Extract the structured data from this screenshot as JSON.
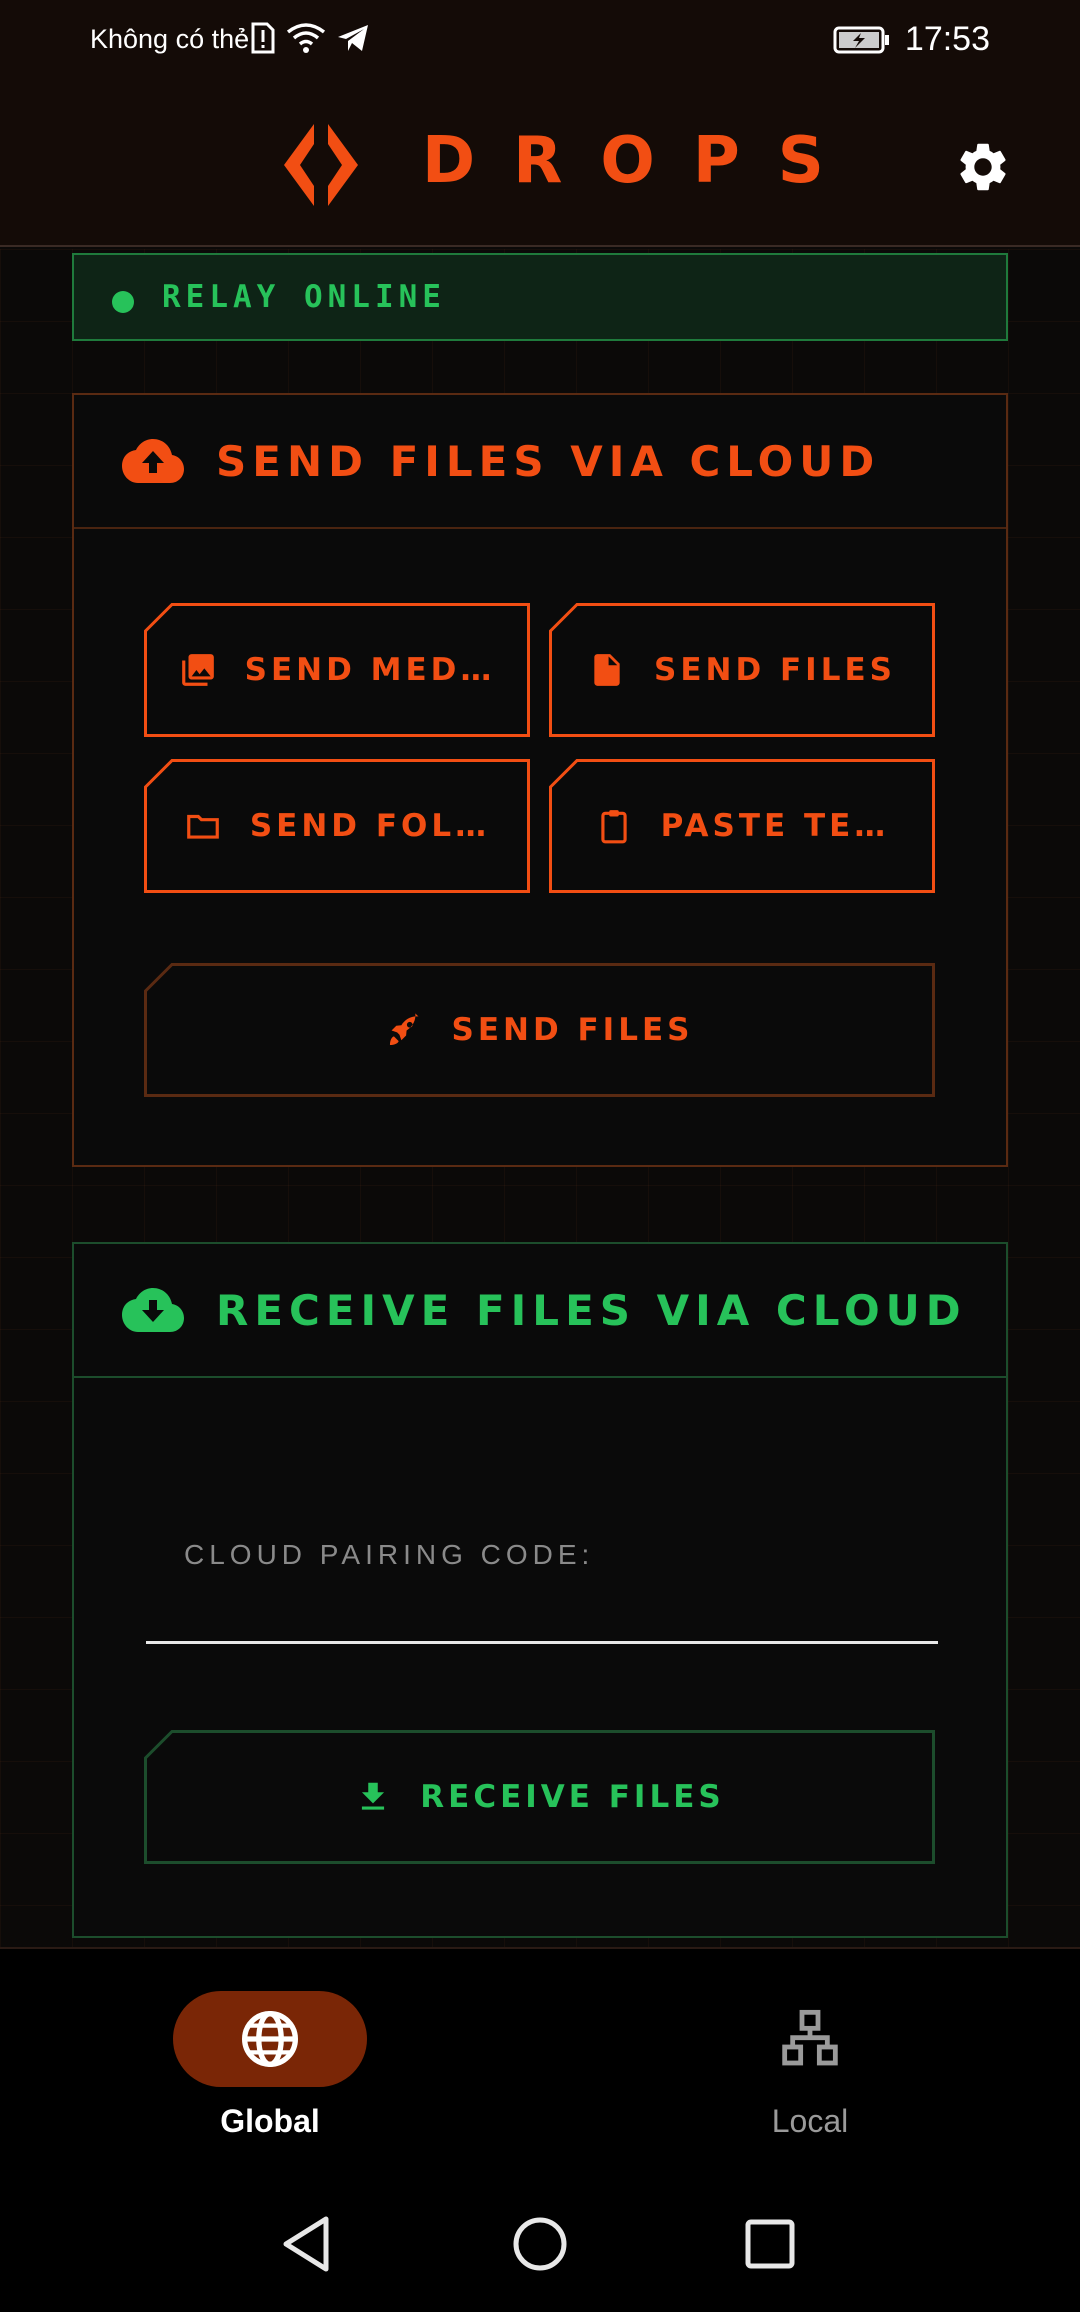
{
  "status_bar": {
    "carrier": "Không có thẻ",
    "time": "17:53",
    "icons": [
      "sim-alert-icon",
      "wifi-icon",
      "telegram-icon",
      "battery-charging-icon"
    ]
  },
  "app_bar": {
    "brand": "DROPS",
    "logo_icon": "drops-logo-icon",
    "settings_icon": "gear-icon"
  },
  "relay": {
    "status": "RELAY ONLINE",
    "color": "#27c25a"
  },
  "send_card": {
    "title": "SEND FILES VIA CLOUD",
    "icon": "cloud-upload-icon",
    "buttons": [
      {
        "label": "SEND MED…",
        "icon": "image-icon"
      },
      {
        "label": "SEND FILES",
        "icon": "file-icon"
      },
      {
        "label": "SEND FOL…",
        "icon": "folder-icon"
      },
      {
        "label": "PASTE TE…",
        "icon": "clipboard-icon"
      }
    ],
    "submit_label": "SEND FILES",
    "submit_icon": "rocket-icon",
    "accent": "#f24e13"
  },
  "receive_card": {
    "title": "RECEIVE FILES VIA CLOUD",
    "icon": "cloud-download-icon",
    "field_label": "CLOUD PAIRING CODE:",
    "field_value": "",
    "submit_label": "RECEIVE FILES",
    "submit_icon": "download-icon",
    "accent": "#27c25a"
  },
  "bottom_nav": {
    "items": [
      {
        "label": "Global",
        "icon": "globe-icon",
        "active": true
      },
      {
        "label": "Local",
        "icon": "network-icon",
        "active": false
      }
    ],
    "active_color": "#7a2606"
  },
  "system_nav": [
    "back-icon",
    "home-icon",
    "recents-icon"
  ]
}
